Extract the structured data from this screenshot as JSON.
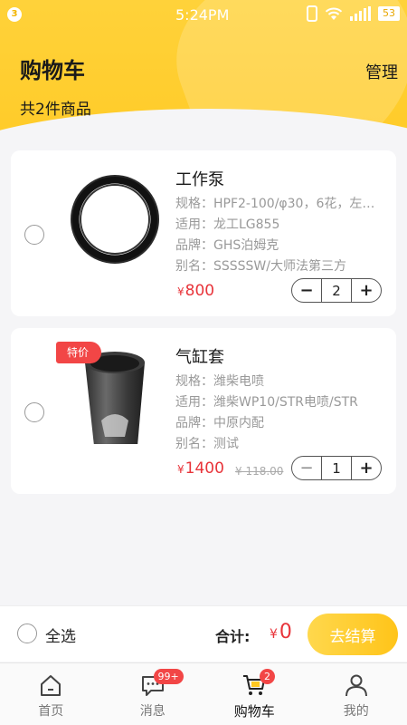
{
  "status_bar": {
    "notification_count": "3",
    "time": "5:24PM",
    "battery": "53"
  },
  "header": {
    "title": "购物车",
    "manage_label": "管理",
    "item_count": "共2件商品"
  },
  "cart_items": [
    {
      "name": "工作泵",
      "spec": "规格：HPF2-100/φ30，6花，左…",
      "fit": "适用：龙工LG855",
      "brand": "品牌：GHS泊姆克",
      "alias": "别名：SSSSSW/大师法第三方",
      "price_symbol": "¥",
      "price": "800",
      "quantity": "2",
      "selected": false
    },
    {
      "tag": "特价",
      "name": "气缸套",
      "spec": "规格：潍柴电喷",
      "fit": "适用：潍柴WP10/STR电喷/STR",
      "brand": "品牌：中原内配",
      "alias": "别名：测试",
      "price_symbol": "¥",
      "price": "1400",
      "old_price": "¥ 118.00",
      "quantity": "1",
      "selected": false
    }
  ],
  "checkout": {
    "select_all_label": "全选",
    "total_label": "合计:",
    "total_symbol": "¥",
    "total_value": "0",
    "checkout_label": "去结算"
  },
  "tabbar": [
    {
      "label": "首页",
      "icon": "home-icon"
    },
    {
      "label": "消息",
      "icon": "message-icon",
      "badge": "99+"
    },
    {
      "label": "购物车",
      "icon": "cart-icon",
      "badge": "2",
      "active": true
    },
    {
      "label": "我的",
      "icon": "profile-icon"
    }
  ],
  "colors": {
    "accent": "#ffc820",
    "price": "#e8343a",
    "badge": "#f24646"
  }
}
